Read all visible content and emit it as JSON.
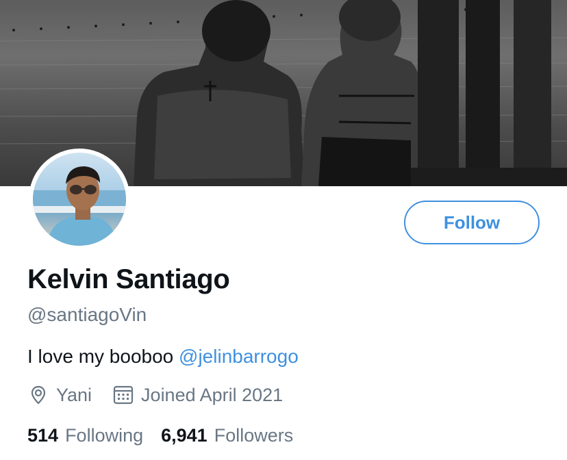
{
  "profile": {
    "name": "Kelvin Santiago",
    "handle": "@santiagoVin",
    "bio_text": "I love my booboo",
    "bio_mention": "@jelinbarrogo",
    "location": "Yani",
    "joined": "Joined April 2021",
    "following_count": "514",
    "following_label": "Following",
    "followers_count": "6,941",
    "followers_label": "Followers"
  },
  "actions": {
    "follow_label": "Follow"
  },
  "icons": {
    "location": "location-pin-icon",
    "calendar": "calendar-icon"
  },
  "colors": {
    "accent": "#3f90df",
    "secondary_text": "#687684",
    "primary_text": "#0f1419"
  }
}
